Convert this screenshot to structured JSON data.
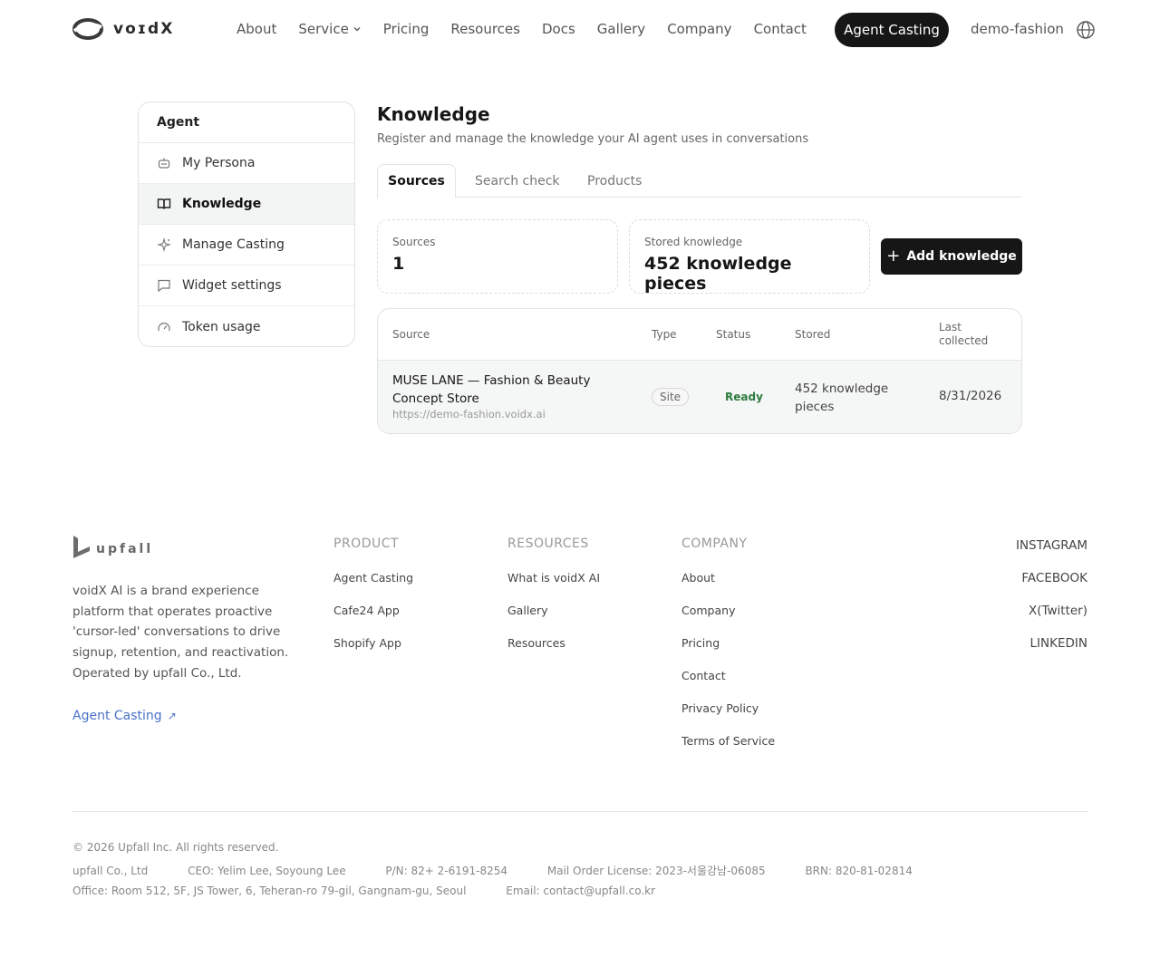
{
  "header": {
    "logo_text": "voɪdX",
    "nav": [
      "About",
      "Service",
      "Pricing",
      "Resources",
      "Docs",
      "Gallery",
      "Company",
      "Contact"
    ],
    "cta_label": "Agent Casting",
    "workspace": "demo-fashion"
  },
  "sidebar": {
    "title": "Agent",
    "items": [
      {
        "label": "My Persona",
        "icon": "robot-icon"
      },
      {
        "label": "Knowledge",
        "icon": "book-icon"
      },
      {
        "label": "Manage Casting",
        "icon": "sparkle-icon"
      },
      {
        "label": "Widget settings",
        "icon": "chat-icon"
      },
      {
        "label": "Token usage",
        "icon": "gauge-icon"
      }
    ],
    "active": "Knowledge"
  },
  "main": {
    "title": "Knowledge",
    "subtitle": "Register and manage the knowledge your AI agent uses in conversations",
    "tabs": [
      "Sources",
      "Search check",
      "Products"
    ],
    "active_tab": "Sources",
    "stats": {
      "sources_label": "Sources",
      "sources_value": "1",
      "stored_label": "Stored knowledge",
      "stored_value": "452 knowledge pieces"
    },
    "add_button": "Add knowledge",
    "table": {
      "headers": [
        "Source",
        "Type",
        "Status",
        "Stored",
        "Last collected"
      ],
      "rows": [
        {
          "name": "MUSE LANE — Fashion & Beauty Concept Store",
          "url": "https://demo-fashion.voidx.ai",
          "type": "Site",
          "status": "Ready",
          "stored": "452 knowledge pieces",
          "last_collected": "8/31/2026"
        }
      ]
    }
  },
  "footer": {
    "logo_text": "upfall",
    "description": "voidX AI is a brand experience platform that operates proactive 'cursor-led' conversations to drive signup, retention, and reactivation. Operated by upfall Co., Ltd.",
    "link": "Agent Casting",
    "columns": [
      {
        "heading": "PRODUCT",
        "items": [
          "Agent Casting",
          "Cafe24 App",
          "Shopify App"
        ]
      },
      {
        "heading": "RESOURCES",
        "items": [
          "What is voidX AI",
          "Gallery",
          "Resources"
        ]
      },
      {
        "heading": "COMPANY",
        "items": [
          "About",
          "Company",
          "Pricing",
          "Contact",
          "Privacy Policy",
          "Terms of Service"
        ]
      }
    ],
    "social": [
      "INSTAGRAM",
      "FACEBOOK",
      "X(Twitter)",
      "LINKEDIN"
    ],
    "copyright": "© 2026 Upfall Inc. All rights reserved.",
    "legal_line1": [
      "upfall Co., Ltd",
      "CEO: Yelim Lee, Soyoung Lee",
      "P/N: 82+ 2-6191-8254",
      "Mail Order License: 2023-서울강남-06085",
      "BRN: 820-81-02814"
    ],
    "legal_line2": [
      "Office: Room 512, 5F, JS Tower, 6, Teheran-ro 79-gil, Gangnam-gu, Seoul",
      "Email: contact@upfall.co.kr"
    ]
  }
}
